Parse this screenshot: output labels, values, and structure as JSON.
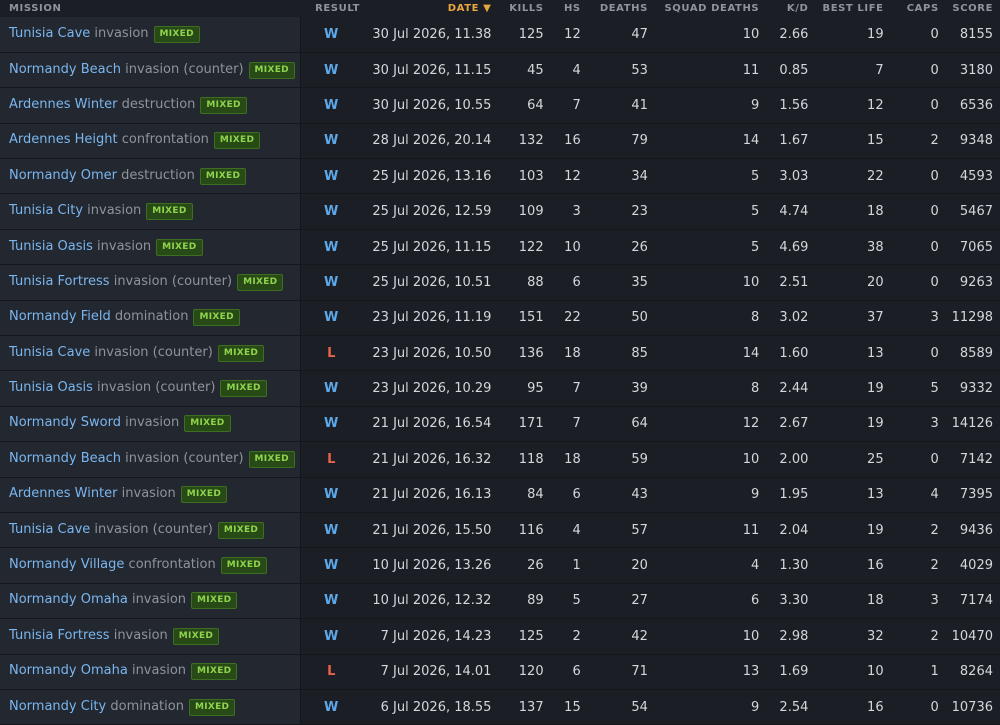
{
  "headers": {
    "mission": "MISSION",
    "result": "RESULT",
    "date": "DATE",
    "date_sort_indicator": "▼",
    "kills": "KILLS",
    "hs": "HS",
    "deaths": "DEATHS",
    "squad_deaths": "SQUAD DEATHS",
    "kd": "K/D",
    "best_life": "BEST LIFE",
    "caps": "CAPS",
    "score": "SCORE"
  },
  "colors": {
    "win": "#5ba8ea",
    "loss": "#e7624f",
    "badge": "#8fd44c",
    "sorted_header": "#e8a640",
    "map_link": "#7ab6ef"
  },
  "rows": [
    {
      "map": "Tunisia Cave",
      "mode": "invasion",
      "badge": "MIXED",
      "result": "W",
      "date": "30 Jul 2026, 11.38",
      "kills": "125",
      "hs": "12",
      "deaths": "47",
      "squad_deaths": "10",
      "kd": "2.66",
      "best_life": "19",
      "caps": "0",
      "score": "8155"
    },
    {
      "map": "Normandy Beach",
      "mode": "invasion (counter)",
      "badge": "MIXED",
      "result": "W",
      "date": "30 Jul 2026, 11.15",
      "kills": "45",
      "hs": "4",
      "deaths": "53",
      "squad_deaths": "11",
      "kd": "0.85",
      "best_life": "7",
      "caps": "0",
      "score": "3180"
    },
    {
      "map": "Ardennes Winter",
      "mode": "destruction",
      "badge": "MIXED",
      "result": "W",
      "date": "30 Jul 2026, 10.55",
      "kills": "64",
      "hs": "7",
      "deaths": "41",
      "squad_deaths": "9",
      "kd": "1.56",
      "best_life": "12",
      "caps": "0",
      "score": "6536"
    },
    {
      "map": "Ardennes Height",
      "mode": "confrontation",
      "badge": "MIXED",
      "result": "W",
      "date": "28 Jul 2026, 20.14",
      "kills": "132",
      "hs": "16",
      "deaths": "79",
      "squad_deaths": "14",
      "kd": "1.67",
      "best_life": "15",
      "caps": "2",
      "score": "9348"
    },
    {
      "map": "Normandy Omer",
      "mode": "destruction",
      "badge": "MIXED",
      "result": "W",
      "date": "25 Jul 2026, 13.16",
      "kills": "103",
      "hs": "12",
      "deaths": "34",
      "squad_deaths": "5",
      "kd": "3.03",
      "best_life": "22",
      "caps": "0",
      "score": "4593"
    },
    {
      "map": "Tunisia City",
      "mode": "invasion",
      "badge": "MIXED",
      "result": "W",
      "date": "25 Jul 2026, 12.59",
      "kills": "109",
      "hs": "3",
      "deaths": "23",
      "squad_deaths": "5",
      "kd": "4.74",
      "best_life": "18",
      "caps": "0",
      "score": "5467"
    },
    {
      "map": "Tunisia Oasis",
      "mode": "invasion",
      "badge": "MIXED",
      "result": "W",
      "date": "25 Jul 2026, 11.15",
      "kills": "122",
      "hs": "10",
      "deaths": "26",
      "squad_deaths": "5",
      "kd": "4.69",
      "best_life": "38",
      "caps": "0",
      "score": "7065"
    },
    {
      "map": "Tunisia Fortress",
      "mode": "invasion (counter)",
      "badge": "MIXED",
      "result": "W",
      "date": "25 Jul 2026, 10.51",
      "kills": "88",
      "hs": "6",
      "deaths": "35",
      "squad_deaths": "10",
      "kd": "2.51",
      "best_life": "20",
      "caps": "0",
      "score": "9263"
    },
    {
      "map": "Normandy Field",
      "mode": "domination",
      "badge": "MIXED",
      "result": "W",
      "date": "23 Jul 2026, 11.19",
      "kills": "151",
      "hs": "22",
      "deaths": "50",
      "squad_deaths": "8",
      "kd": "3.02",
      "best_life": "37",
      "caps": "3",
      "score": "11298"
    },
    {
      "map": "Tunisia Cave",
      "mode": "invasion (counter)",
      "badge": "MIXED",
      "result": "L",
      "date": "23 Jul 2026, 10.50",
      "kills": "136",
      "hs": "18",
      "deaths": "85",
      "squad_deaths": "14",
      "kd": "1.60",
      "best_life": "13",
      "caps": "0",
      "score": "8589"
    },
    {
      "map": "Tunisia Oasis",
      "mode": "invasion (counter)",
      "badge": "MIXED",
      "result": "W",
      "date": "23 Jul 2026, 10.29",
      "kills": "95",
      "hs": "7",
      "deaths": "39",
      "squad_deaths": "8",
      "kd": "2.44",
      "best_life": "19",
      "caps": "5",
      "score": "9332"
    },
    {
      "map": "Normandy Sword",
      "mode": "invasion",
      "badge": "MIXED",
      "result": "W",
      "date": "21 Jul 2026, 16.54",
      "kills": "171",
      "hs": "7",
      "deaths": "64",
      "squad_deaths": "12",
      "kd": "2.67",
      "best_life": "19",
      "caps": "3",
      "score": "14126"
    },
    {
      "map": "Normandy Beach",
      "mode": "invasion (counter)",
      "badge": "MIXED",
      "result": "L",
      "date": "21 Jul 2026, 16.32",
      "kills": "118",
      "hs": "18",
      "deaths": "59",
      "squad_deaths": "10",
      "kd": "2.00",
      "best_life": "25",
      "caps": "0",
      "score": "7142"
    },
    {
      "map": "Ardennes Winter",
      "mode": "invasion",
      "badge": "MIXED",
      "result": "W",
      "date": "21 Jul 2026, 16.13",
      "kills": "84",
      "hs": "6",
      "deaths": "43",
      "squad_deaths": "9",
      "kd": "1.95",
      "best_life": "13",
      "caps": "4",
      "score": "7395"
    },
    {
      "map": "Tunisia Cave",
      "mode": "invasion (counter)",
      "badge": "MIXED",
      "result": "W",
      "date": "21 Jul 2026, 15.50",
      "kills": "116",
      "hs": "4",
      "deaths": "57",
      "squad_deaths": "11",
      "kd": "2.04",
      "best_life": "19",
      "caps": "2",
      "score": "9436"
    },
    {
      "map": "Normandy Village",
      "mode": "confrontation",
      "badge": "MIXED",
      "result": "W",
      "date": "10 Jul 2026, 13.26",
      "kills": "26",
      "hs": "1",
      "deaths": "20",
      "squad_deaths": "4",
      "kd": "1.30",
      "best_life": "16",
      "caps": "2",
      "score": "4029"
    },
    {
      "map": "Normandy Omaha",
      "mode": "invasion",
      "badge": "MIXED",
      "result": "W",
      "date": "10 Jul 2026, 12.32",
      "kills": "89",
      "hs": "5",
      "deaths": "27",
      "squad_deaths": "6",
      "kd": "3.30",
      "best_life": "18",
      "caps": "3",
      "score": "7174"
    },
    {
      "map": "Tunisia Fortress",
      "mode": "invasion",
      "badge": "MIXED",
      "result": "W",
      "date": "7 Jul 2026, 14.23",
      "kills": "125",
      "hs": "2",
      "deaths": "42",
      "squad_deaths": "10",
      "kd": "2.98",
      "best_life": "32",
      "caps": "2",
      "score": "10470"
    },
    {
      "map": "Normandy Omaha",
      "mode": "invasion",
      "badge": "MIXED",
      "result": "L",
      "date": "7 Jul 2026, 14.01",
      "kills": "120",
      "hs": "6",
      "deaths": "71",
      "squad_deaths": "13",
      "kd": "1.69",
      "best_life": "10",
      "caps": "1",
      "score": "8264"
    },
    {
      "map": "Normandy City",
      "mode": "domination",
      "badge": "MIXED",
      "result": "W",
      "date": "6 Jul 2026, 18.55",
      "kills": "137",
      "hs": "15",
      "deaths": "54",
      "squad_deaths": "9",
      "kd": "2.54",
      "best_life": "16",
      "caps": "0",
      "score": "10736"
    }
  ]
}
